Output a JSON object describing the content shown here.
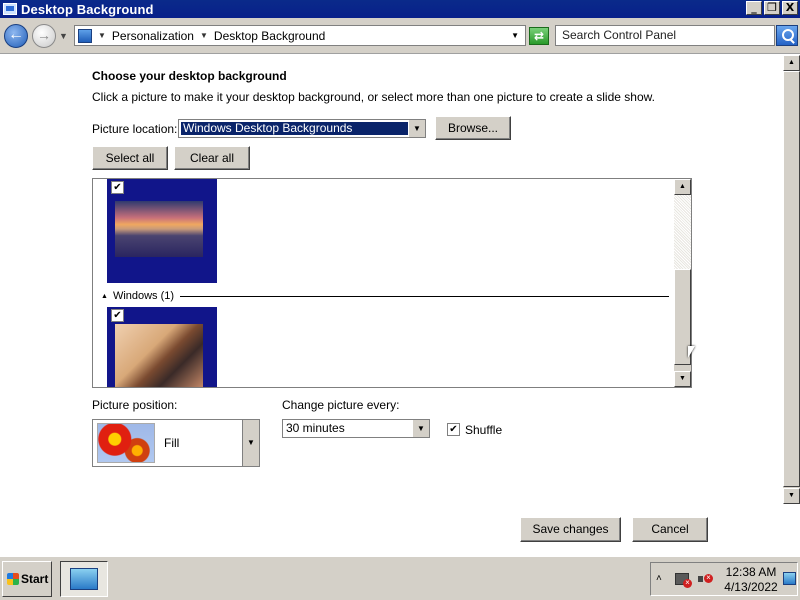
{
  "window": {
    "title": "Desktop Background"
  },
  "titlebar_controls": [
    "_",
    "❐",
    "X"
  ],
  "address": {
    "crumbs": [
      "Personalization",
      "Desktop Background"
    ],
    "search_placeholder": "Search Control Panel"
  },
  "main": {
    "heading": "Choose your desktop background",
    "subheading": "Click a picture to make it your desktop background, or select more than one picture to create a slide show.",
    "picture_location_label": "Picture location:",
    "picture_location_value": "Windows Desktop Backgrounds",
    "browse_label": "Browse...",
    "select_all_label": "Select all",
    "clear_all_label": "Clear all",
    "gallery": {
      "group_label": "Windows (1)",
      "tiles": [
        {
          "checked": "✔",
          "image": "lake-sunset-photo"
        },
        {
          "checked": "✔",
          "image": "chocolate-photo"
        }
      ]
    },
    "picture_position_label": "Picture position:",
    "picture_position_value": "Fill",
    "change_every_label": "Change picture every:",
    "change_every_value": "30 minutes",
    "shuffle_label": "Shuffle",
    "shuffle_checked": "✔",
    "save_label": "Save changes",
    "cancel_label": "Cancel"
  },
  "taskbar": {
    "start_label": "Start",
    "clock_time": "12:38 AM",
    "clock_date": "4/13/2022"
  },
  "colors": {
    "titlebar": "#0a2a8a",
    "selection": "#0a246a",
    "tile_background": "#11158a",
    "chrome": "#d4d0c8"
  }
}
